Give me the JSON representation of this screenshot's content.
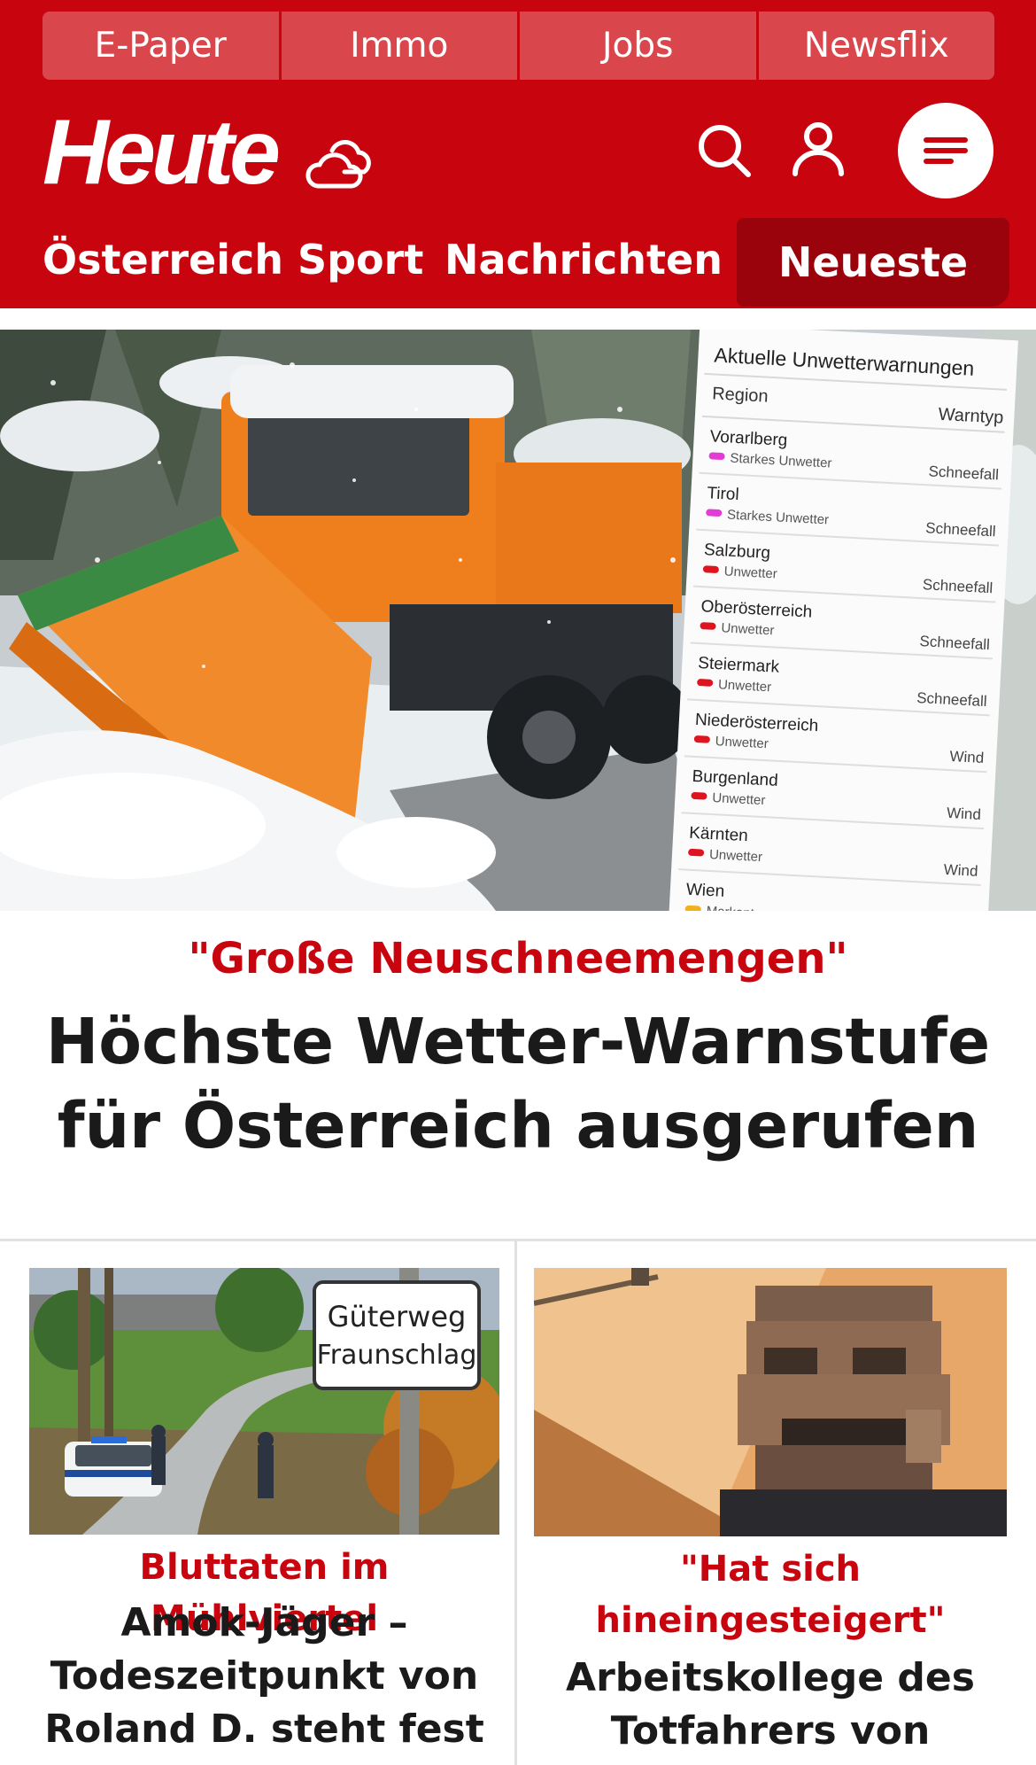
{
  "header": {
    "toplinks": [
      "E-Paper",
      "Immo",
      "Jobs",
      "Newsflix"
    ],
    "logo": "Heute",
    "nav": [
      "Österreich",
      "Sport",
      "Nachrichten",
      "Neueste"
    ],
    "brand_color": "#c8050f",
    "active_tab_color": "#9a030b"
  },
  "hero": {
    "warning_table": {
      "title": "Aktuelle Unwetterwarnungen",
      "col_region": "Region",
      "col_type": "Warntyp",
      "rows": [
        {
          "region": "Vorarlberg",
          "level": "Starkes Unwetter",
          "type": "Schneefall",
          "color": "#e23bd6"
        },
        {
          "region": "Tirol",
          "level": "Starkes Unwetter",
          "type": "Schneefall",
          "color": "#e23bd6"
        },
        {
          "region": "Salzburg",
          "level": "Unwetter",
          "type": "Schneefall",
          "color": "#e0141e"
        },
        {
          "region": "Oberösterreich",
          "level": "Unwetter",
          "type": "Schneefall",
          "color": "#e0141e"
        },
        {
          "region": "Steiermark",
          "level": "Unwetter",
          "type": "Schneefall",
          "color": "#e0141e"
        },
        {
          "region": "Niederösterreich",
          "level": "Unwetter",
          "type": "Wind",
          "color": "#e0141e"
        },
        {
          "region": "Burgenland",
          "level": "Unwetter",
          "type": "Wind",
          "color": "#e0141e"
        },
        {
          "region": "Kärnten",
          "level": "Unwetter",
          "type": "Wind",
          "color": "#e0141e"
        },
        {
          "region": "Wien",
          "level": "Markant",
          "type": "",
          "color": "#f2b01e"
        }
      ]
    },
    "kicker": "\"Große Neuschneemengen\"",
    "title": "Höchste Wetter-Warnstufe für Österreich ausgerufen"
  },
  "cards": [
    {
      "sign_line1": "Güterweg",
      "sign_line2": "Fraunschlag",
      "kicker": "Bluttaten im Mühlviertel",
      "title_lines": [
        "Amok-Jäger –",
        "Todeszeitpunkt von",
        "Roland D. steht fest"
      ]
    },
    {
      "kicker_lines": [
        "\"Hat sich",
        "hineingesteigert\""
      ],
      "title_lines": [
        "Arbeitskollege des",
        "Totfahrers von"
      ]
    }
  ]
}
